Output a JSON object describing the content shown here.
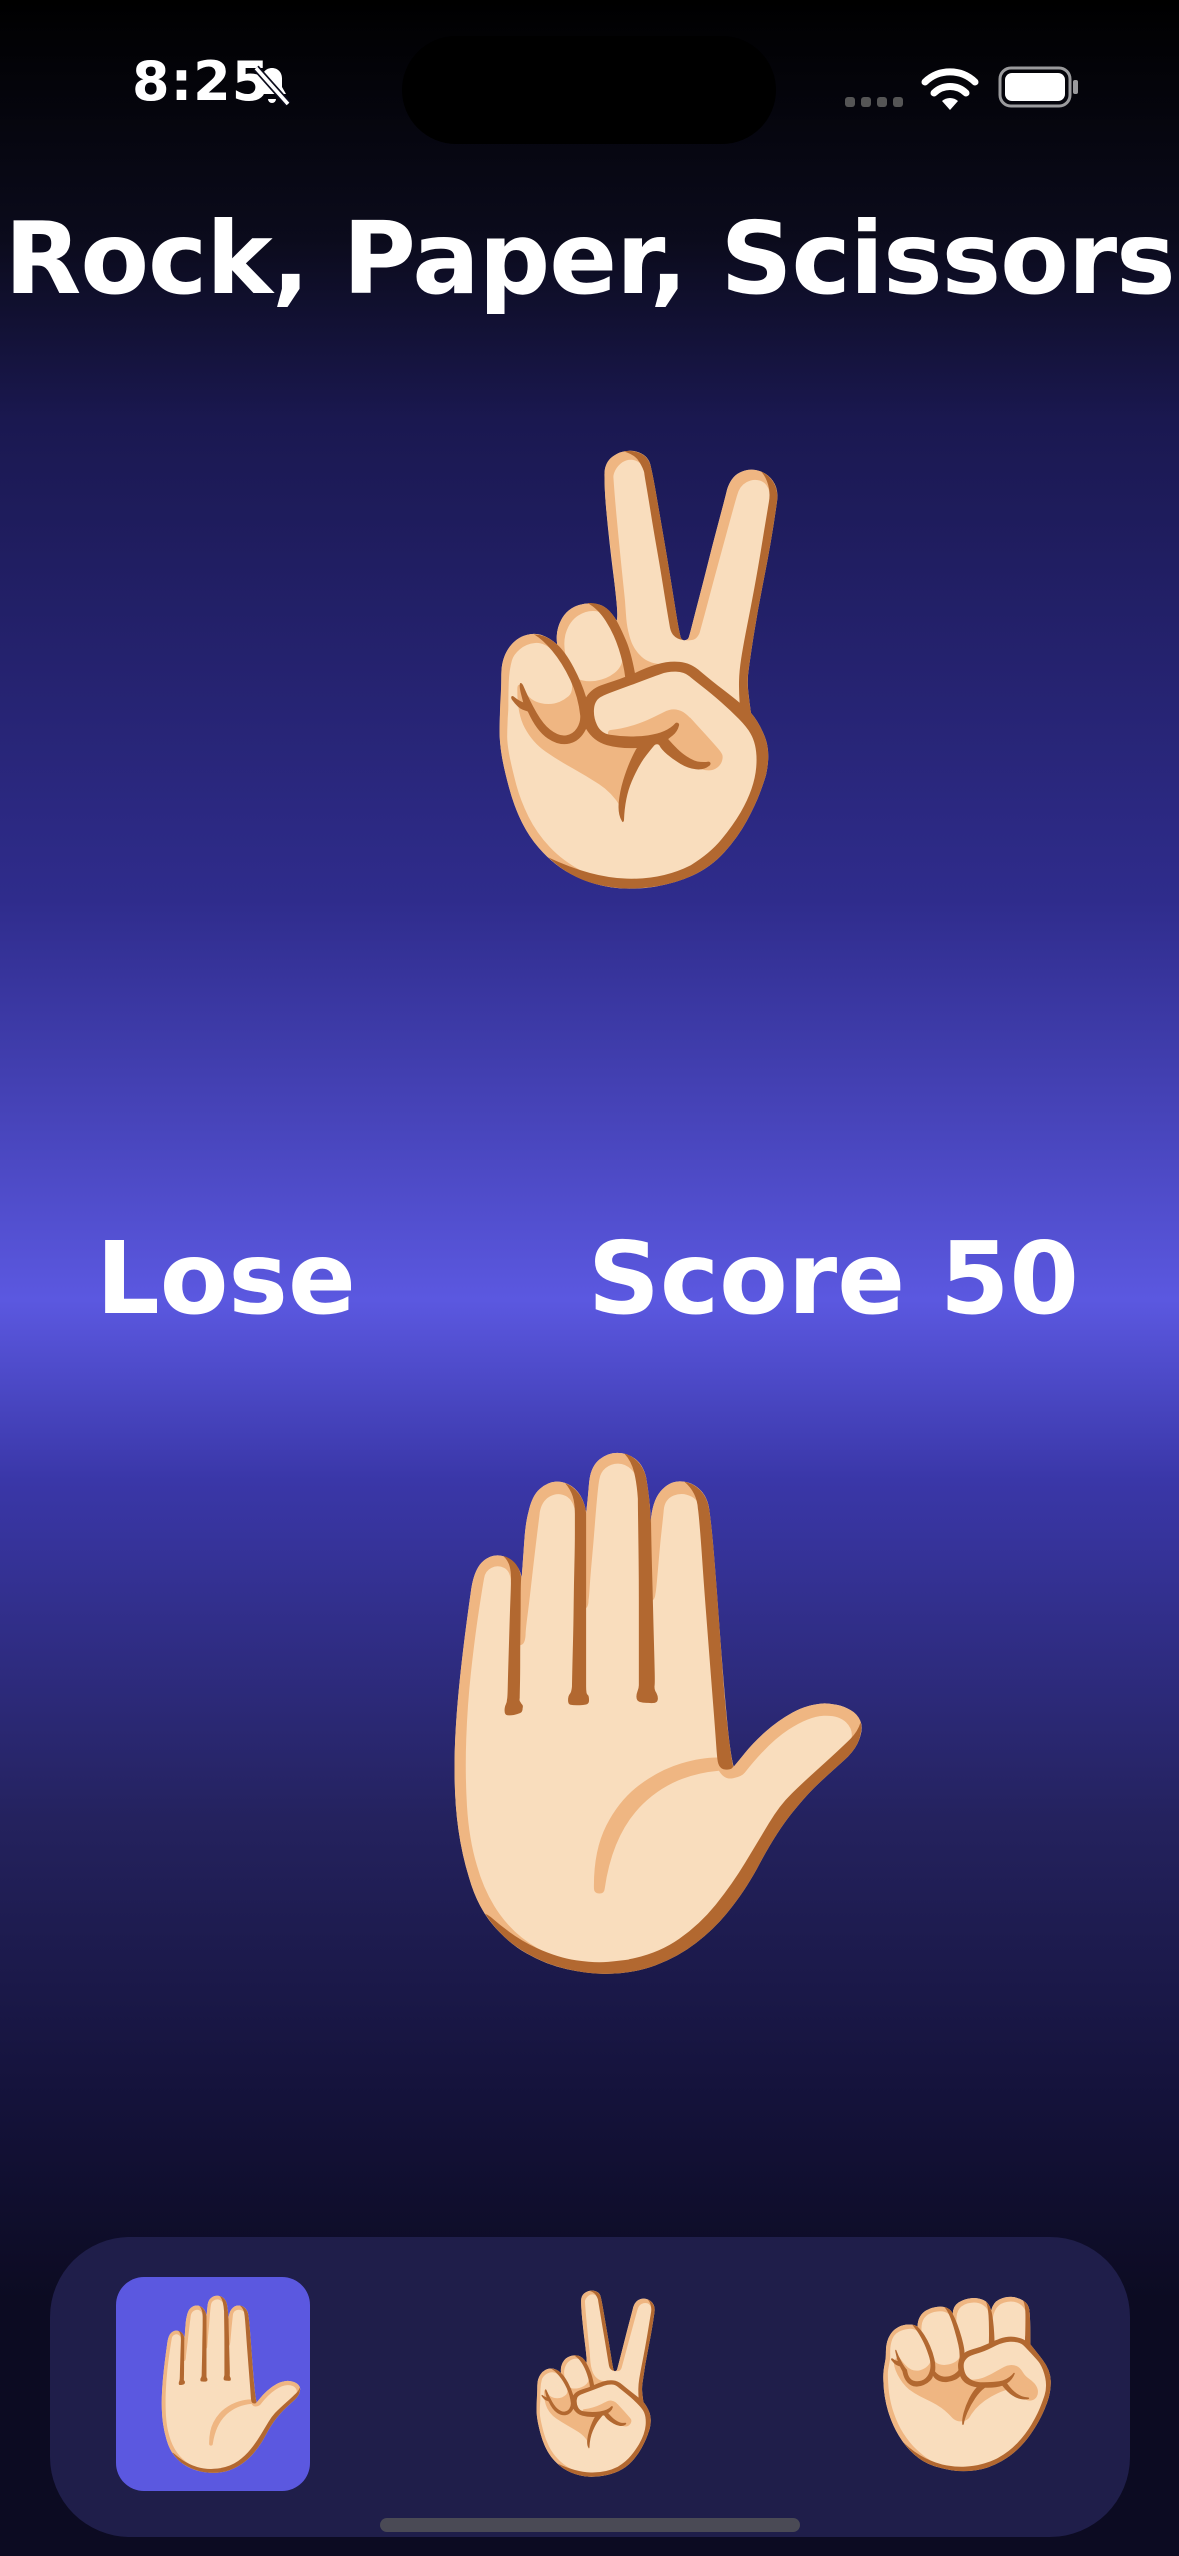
{
  "status_bar": {
    "time": "8:25"
  },
  "title": "Rock, Paper, Scissors",
  "opponent_choice_emoji": "✌🏻",
  "result": "Lose",
  "score_label": "Score 50",
  "player_choice_emoji": "✋🏻",
  "options": [
    {
      "name": "paper",
      "emoji": "✋🏻",
      "selected": true
    },
    {
      "name": "scissors",
      "emoji": "✌🏻",
      "selected": false
    },
    {
      "name": "rock",
      "emoji": "✊🏻",
      "selected": false
    }
  ],
  "colors": {
    "accent": "#5b58e0",
    "tray": "#1f1e4a"
  },
  "icons": [
    "bell-slash-icon",
    "cellular-signal-icon",
    "wifi-icon",
    "battery-icon"
  ]
}
